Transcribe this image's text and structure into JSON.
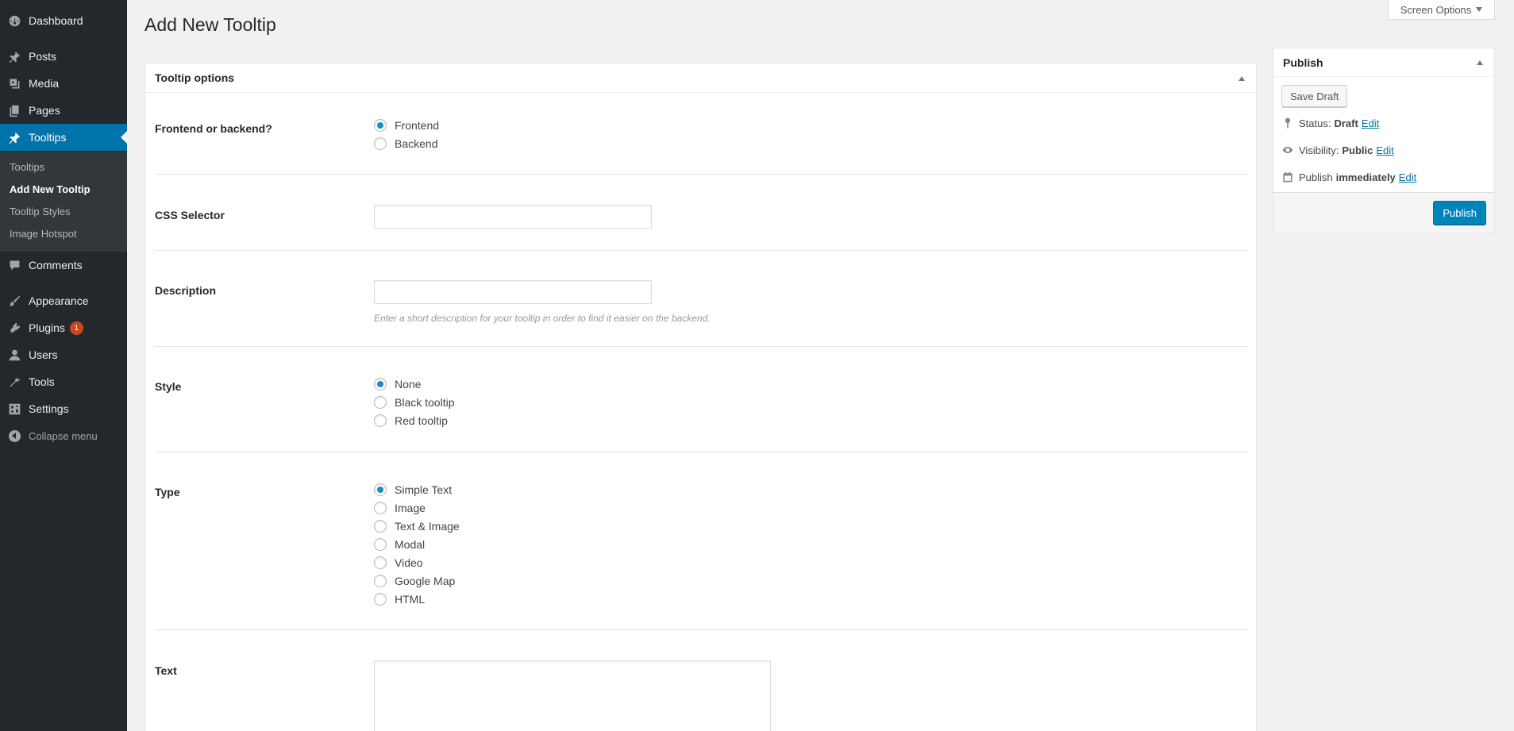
{
  "sidebar": {
    "items": [
      {
        "label": "Dashboard",
        "icon": "dashboard-icon"
      },
      {
        "label": "Posts",
        "icon": "pin-icon"
      },
      {
        "label": "Media",
        "icon": "media-icon"
      },
      {
        "label": "Pages",
        "icon": "pages-icon"
      },
      {
        "label": "Tooltips",
        "icon": "pin-icon"
      },
      {
        "label": "Comments",
        "icon": "comment-icon"
      },
      {
        "label": "Appearance",
        "icon": "brush-icon"
      },
      {
        "label": "Plugins",
        "icon": "plugin-icon",
        "badge": "1"
      },
      {
        "label": "Users",
        "icon": "user-icon"
      },
      {
        "label": "Tools",
        "icon": "wrench-icon"
      },
      {
        "label": "Settings",
        "icon": "settings-icon"
      }
    ],
    "submenu": [
      "Tooltips",
      "Add New Tooltip",
      "Tooltip Styles",
      "Image Hotspot"
    ],
    "collapse_label": "Collapse menu"
  },
  "header": {
    "title": "Add New Tooltip",
    "screen_options": "Screen Options"
  },
  "tooltip_options": {
    "title": "Tooltip options",
    "frontend_backend": {
      "label": "Frontend or backend?",
      "options": [
        "Frontend",
        "Backend"
      ],
      "selected": "Frontend"
    },
    "css_selector": {
      "label": "CSS Selector",
      "value": ""
    },
    "description": {
      "label": "Description",
      "value": "",
      "hint": "Enter a short description for your tooltip in order to find it easier on the backend."
    },
    "style": {
      "label": "Style",
      "options": [
        "None",
        "Black tooltip",
        "Red tooltip"
      ],
      "selected": "None"
    },
    "type": {
      "label": "Type",
      "options": [
        "Simple Text",
        "Image",
        "Text & Image",
        "Modal",
        "Video",
        "Google Map",
        "HTML"
      ],
      "selected": "Simple Text"
    },
    "text": {
      "label": "Text",
      "value": ""
    }
  },
  "publish": {
    "title": "Publish",
    "save_draft": "Save Draft",
    "status_label": "Status:",
    "status_value": "Draft",
    "visibility_label": "Visibility:",
    "visibility_value": "Public",
    "publish_label": "Publish",
    "publish_value": "immediately",
    "edit": "Edit",
    "publish_button": "Publish"
  },
  "colors": {
    "sidebar_bg": "#23282d",
    "active_menu": "#0073aa",
    "primary_button": "#0085ba",
    "badge": "#ca4a1f"
  }
}
